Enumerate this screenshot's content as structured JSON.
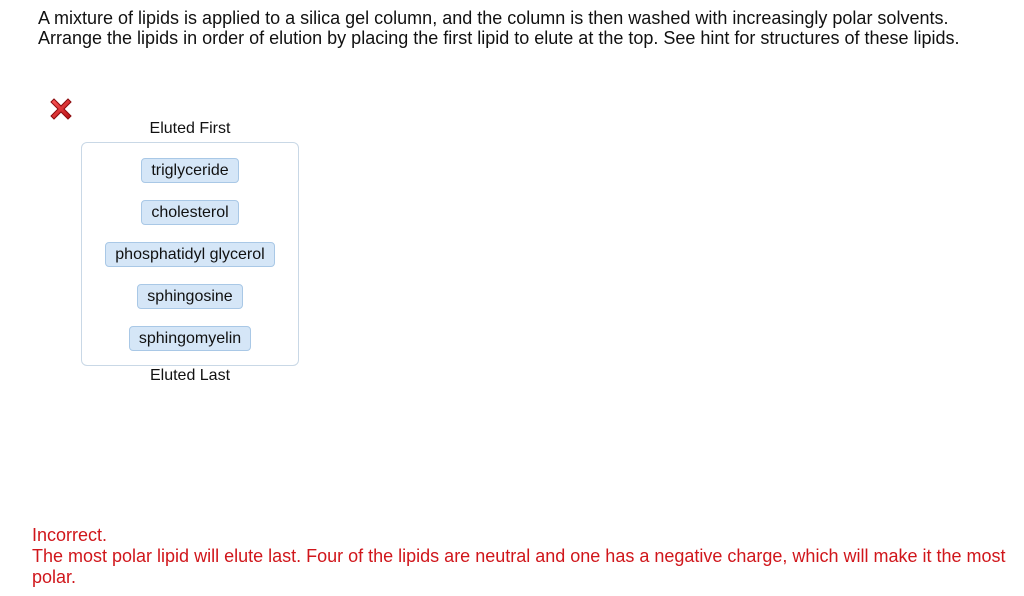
{
  "question": {
    "text": "A mixture of lipids is applied to a silica gel column, and the column is then washed with increasingly polar solvents. Arrange the lipids in order of elution by placing the first lipid to elute at the top. See hint for structures of these lipids."
  },
  "result_icon": "incorrect-x-icon",
  "column": {
    "top_label": "Eluted First",
    "bottom_label": "Eluted Last",
    "items": [
      {
        "label": "triglyceride"
      },
      {
        "label": "cholesterol"
      },
      {
        "label": "phosphatidyl glycerol"
      },
      {
        "label": "sphingosine"
      },
      {
        "label": "sphingomyelin"
      }
    ]
  },
  "feedback": {
    "status": "Incorrect.",
    "message": "The most polar lipid will elute last. Four of the lipids are neutral and one has a negative charge, which will make it the most polar."
  },
  "colors": {
    "feedback_text": "#d0161b",
    "chip_fill": "#d5e6f7",
    "chip_border": "#a9c8e6",
    "x_icon": "#e0191e"
  }
}
